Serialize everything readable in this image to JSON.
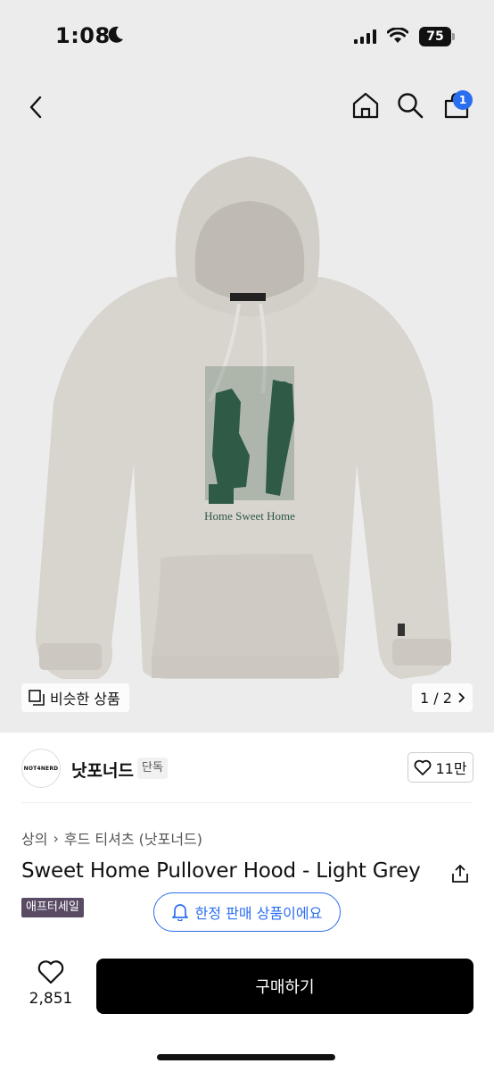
{
  "status": {
    "time": "1:08",
    "battery": "75"
  },
  "nav": {
    "cart_count": "1"
  },
  "hero": {
    "print_text": "Home Sweet Home",
    "similar_label": "비슷한 상품",
    "page_indicator": "1 / 2"
  },
  "brand": {
    "logo_text": "NOT4NERD",
    "name": "낫포너드",
    "tag": "단독",
    "likes": "11만"
  },
  "breadcrumb": {
    "category": "상의",
    "separator": "›",
    "subcategory": "후드 티셔츠 (낫포너드)"
  },
  "product": {
    "title": "Sweet Home Pullover Hood - Light Grey",
    "sale_badge": "애프터세일",
    "limited_label": "한정 판매 상품이에요"
  },
  "bottom": {
    "wish_count": "2,851",
    "buy_label": "구매하기"
  },
  "colors": {
    "accent": "#2a6ef0",
    "sale_badge": "#5a4b64",
    "buy_button": "#000000",
    "hoodie": "#d8d4ce",
    "print": "#2f5a45"
  }
}
